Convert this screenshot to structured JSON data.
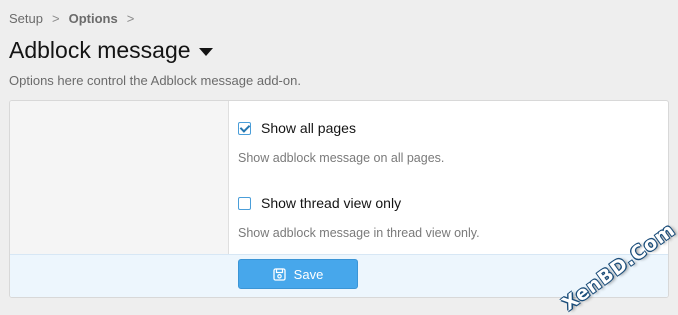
{
  "breadcrumb": {
    "items": [
      {
        "label": "Setup"
      },
      {
        "label": "Options"
      }
    ],
    "separator": ">"
  },
  "page": {
    "title": "Adblock message",
    "description": "Options here control the Adblock message add-on."
  },
  "options": [
    {
      "label": "Show all pages",
      "checked": true,
      "hint": "Show adblock message on all pages."
    },
    {
      "label": "Show thread view only",
      "checked": false,
      "hint": "Show adblock message in thread view only."
    }
  ],
  "footer": {
    "save_label": "Save"
  },
  "watermark": {
    "text": "XenBD.Com"
  },
  "colors": {
    "accent": "#47a7eb",
    "checkbox_border": "#4a9ed9",
    "background": "#eeeeee"
  },
  "icons": {
    "title_dropdown": "caret-down-icon",
    "checkbox_checked": "checkmark-icon",
    "save": "save-icon"
  }
}
